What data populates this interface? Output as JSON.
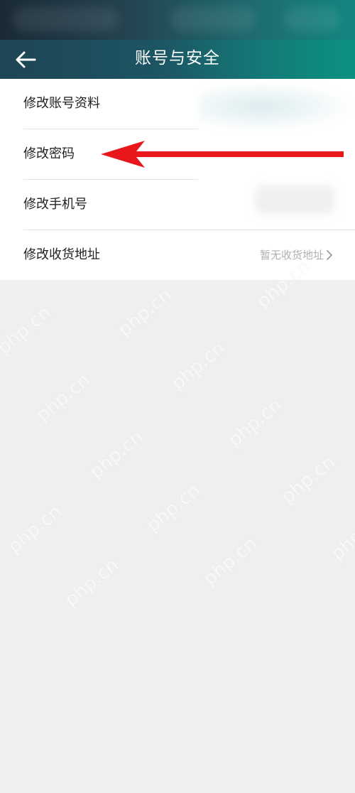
{
  "header": {
    "title": "账号与安全",
    "back_icon": "arrow-left-icon"
  },
  "menu": {
    "items": [
      {
        "label": "修改账号资料",
        "value": ""
      },
      {
        "label": "修改密码",
        "value": ""
      },
      {
        "label": "修改手机号",
        "value": ""
      },
      {
        "label": "修改收货地址",
        "value": "暂无收货地址"
      }
    ]
  },
  "watermark": {
    "text": "php.cn"
  },
  "colors": {
    "header_start": "#1e4556",
    "header_end": "#0c9180",
    "annotation_arrow": "#e8171b",
    "page_background": "#efefef"
  }
}
